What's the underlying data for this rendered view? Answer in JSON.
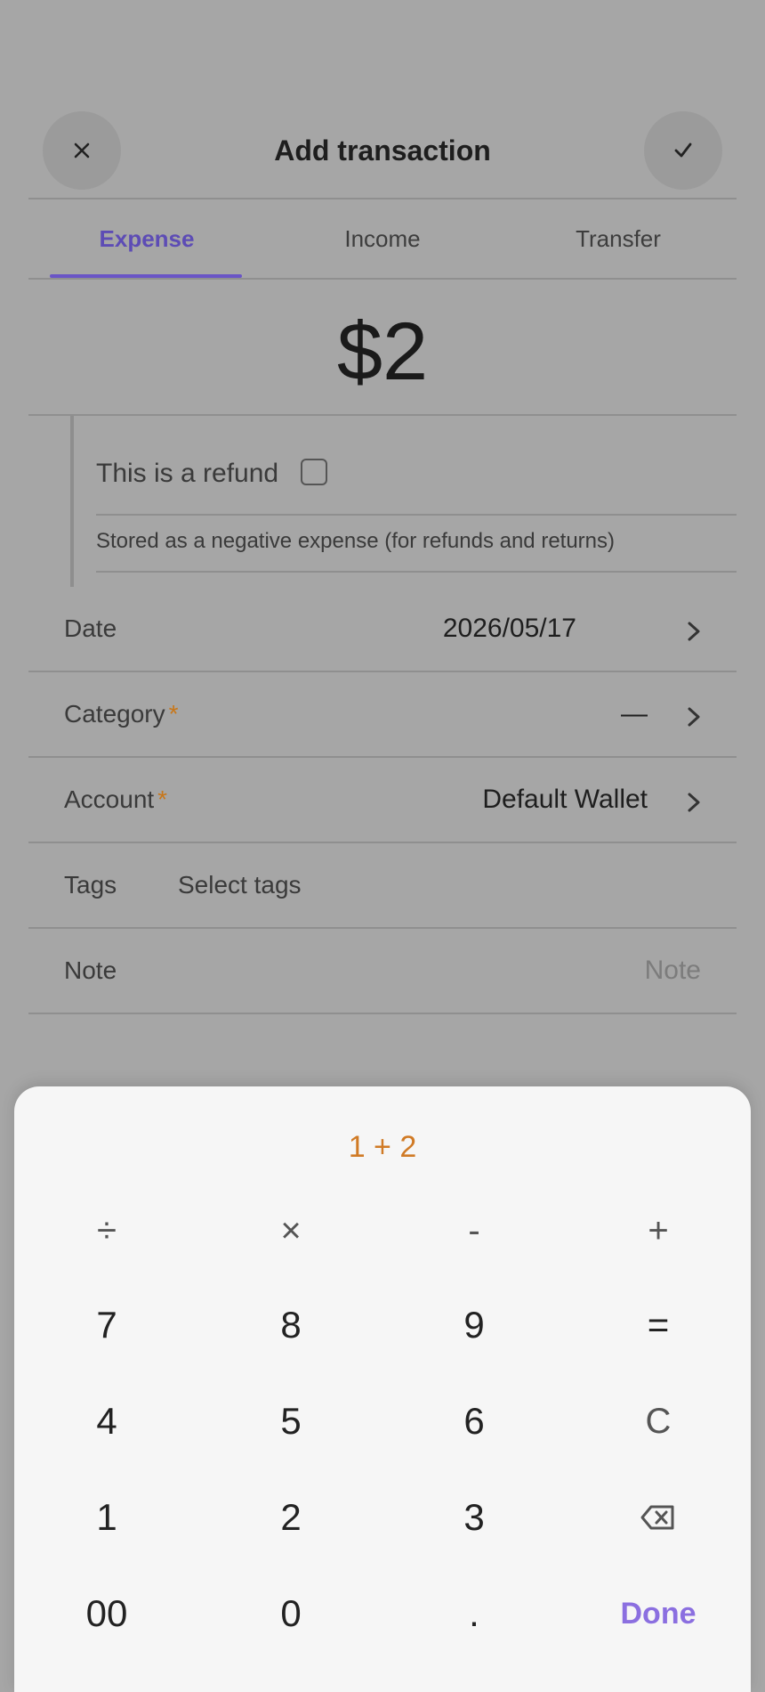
{
  "header": {
    "title": "Add transaction",
    "close_icon": "close-icon",
    "confirm_icon": "check-icon"
  },
  "tabs": [
    {
      "label": "Expense",
      "active": true
    },
    {
      "label": "Income",
      "active": false
    },
    {
      "label": "Transfer",
      "active": false
    }
  ],
  "amount": "$2",
  "refund": {
    "label": "This is a refund",
    "checked": false,
    "hint": "Stored as a negative expense (for refunds and returns)"
  },
  "form": {
    "date": {
      "label": "Date",
      "value": "2026/05/17"
    },
    "category": {
      "label": "Category",
      "required_mark": "*",
      "value": "—"
    },
    "account": {
      "label": "Account",
      "required_mark": "*",
      "value": "Default Wallet"
    },
    "tags": {
      "label": "Tags",
      "value": "Select tags"
    },
    "note": {
      "label": "Note",
      "placeholder": "Note"
    }
  },
  "keypad": {
    "expression": "1 + 2",
    "operators": [
      "÷",
      "×",
      "-",
      "+"
    ],
    "rows": [
      [
        "7",
        "8",
        "9",
        "="
      ],
      [
        "4",
        "5",
        "6",
        "C"
      ],
      [
        "1",
        "2",
        "3",
        "backspace"
      ],
      [
        "00",
        "0",
        ".",
        "Done"
      ]
    ]
  },
  "colors": {
    "accent": "#6a55c6",
    "required": "#c8771a",
    "expression": "#d07a25",
    "done": "#8b6fe0"
  }
}
